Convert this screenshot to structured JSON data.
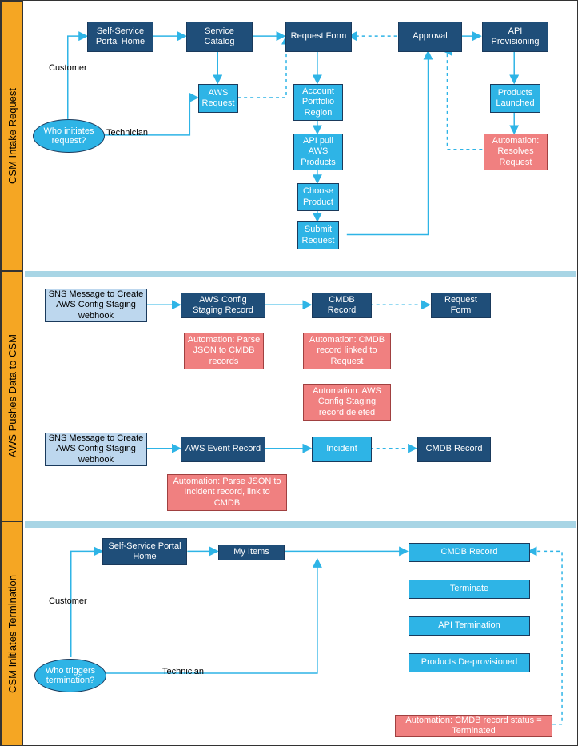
{
  "lanes": {
    "intake": "CSM Intake Request",
    "push": "AWS Pushes Data to CSM",
    "term": "CSM Initiates Termination"
  },
  "intake": {
    "decision": "Who initiates request?",
    "customer": "Customer",
    "technician": "Technician",
    "portal": "Self-Service Portal Home",
    "catalog": "Service Catalog",
    "awsReq": "AWS Request",
    "reqForm": "Request Form",
    "account": "Account Portfolio Region",
    "apiPull": "API pull AWS Products",
    "choose": "Choose Product",
    "submit": "Submit Request",
    "approval": "Approval",
    "apiProv": "API Provisioning",
    "launched": "Products Launched",
    "resolves": "Automation: Resolves Request"
  },
  "push": {
    "sns1": "SNS Message to Create AWS Config Staging webhook",
    "staging": "AWS Config Staging Record",
    "cmdb1": "CMDB Record",
    "reqForm": "Request Form",
    "autoParse": "Automation: Parse JSON to CMDB records",
    "autoLink": "Automation: CMDB record linked to Request",
    "autoDel": "Automation: AWS Config Staging record deleted",
    "sns2": "SNS Message to Create AWS Config Staging webhook",
    "event": "AWS Event Record",
    "incident": "Incident",
    "cmdb2": "CMDB Record",
    "autoInc": "Automation: Parse JSON to Incident record, link to CMDB"
  },
  "term": {
    "decision": "Who triggers termination?",
    "customer": "Customer",
    "technician": "Technician",
    "portal": "Self-Service Portal Home",
    "myItems": "My Items",
    "cmdb": "CMDB Record",
    "terminate": "Terminate",
    "apiTerm": "API Termination",
    "deprov": "Products De-provisioned",
    "autoTerm": "Automation: CMDB record status = Terminated"
  }
}
